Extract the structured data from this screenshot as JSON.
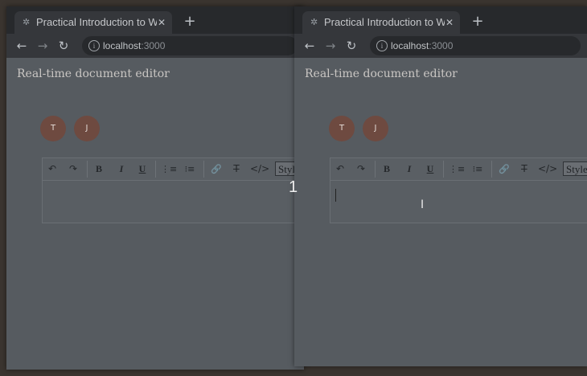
{
  "windows": [
    {
      "tab": {
        "title": "Practical Introduction to WebSocket",
        "icon": "gear-icon"
      },
      "url": {
        "host": "localhost",
        "port": ":3000"
      },
      "app_title": "Real-time document editor",
      "avatars": [
        "T",
        "J"
      ],
      "toolbar": {
        "undo": "↶",
        "redo": "↷",
        "bold": "B",
        "italic": "I",
        "underline": "U",
        "ordered": "⋮≡",
        "bullet": "⁝≡",
        "link": "🔗",
        "clear": "T̶",
        "code": "</>",
        "style": "Styles"
      }
    },
    {
      "tab": {
        "title": "Practical Introduction to WebSocket",
        "icon": "gear-icon"
      },
      "url": {
        "host": "localhost",
        "port": ":3000"
      },
      "app_title": "Real-time document editor",
      "avatars": [
        "T",
        "J"
      ],
      "toolbar": {
        "undo": "↶",
        "redo": "↷",
        "bold": "B",
        "italic": "I",
        "underline": "U",
        "ordered": "⋮≡",
        "bullet": "⁝≡",
        "link": "🔗",
        "clear": "T̶",
        "code": "</>",
        "style": "Styles"
      }
    }
  ],
  "browser": {
    "new_tab": "+",
    "close": "✕",
    "back": "←",
    "forward": "→",
    "reload": "↻",
    "info": "i"
  },
  "overlay": {
    "counter": "1",
    "cursor": "I"
  }
}
